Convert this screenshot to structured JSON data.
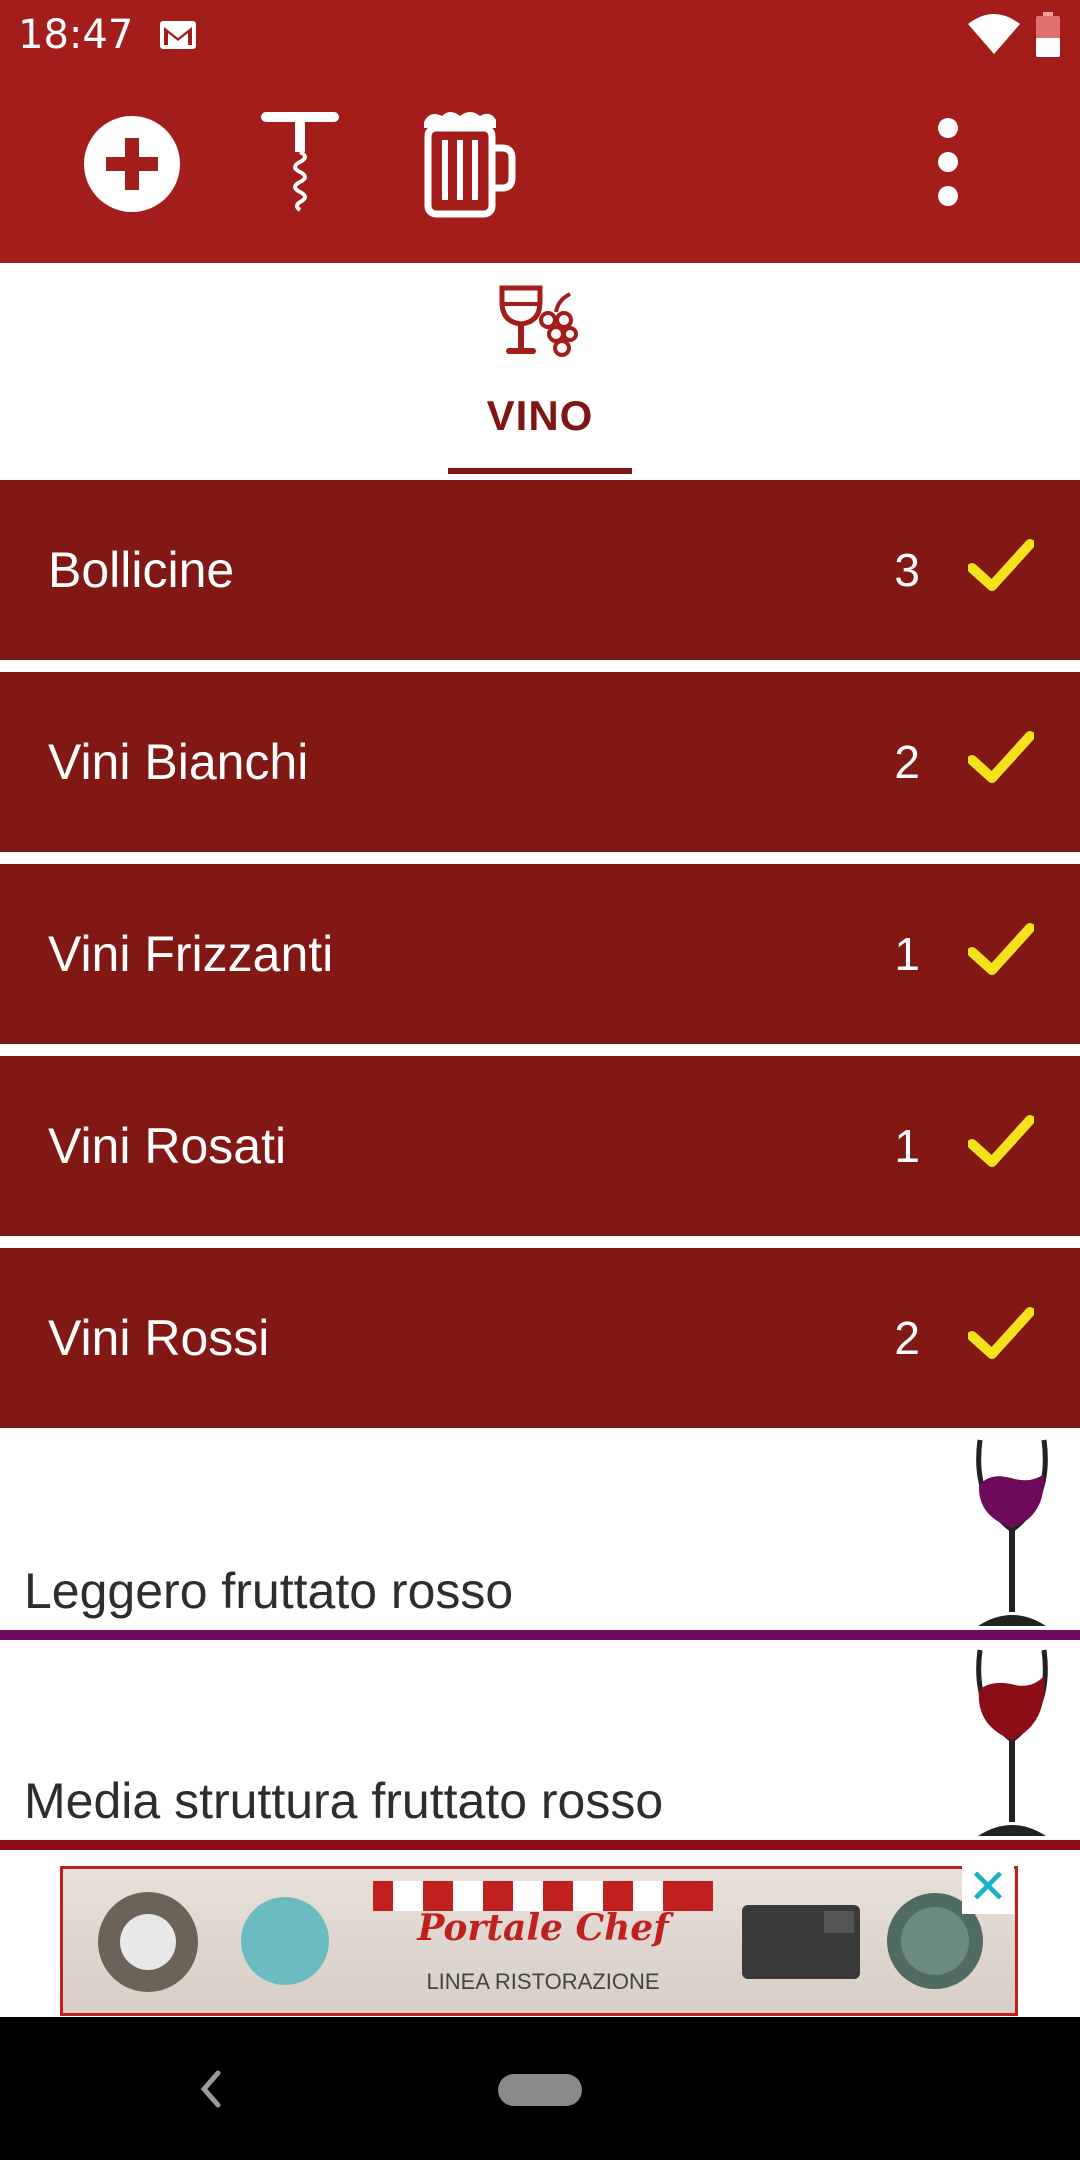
{
  "status_bar": {
    "time": "18:47"
  },
  "toolbar": {
    "actions": [
      "plus-circle-icon",
      "corkscrew-icon",
      "beer-mug-icon",
      "more-vert-icon"
    ]
  },
  "tab": {
    "label": "VINO",
    "icon": "wine-grapes-icon"
  },
  "categories": [
    {
      "label": "Bollicine",
      "count": "3"
    },
    {
      "label": "Vini Bianchi",
      "count": "2"
    },
    {
      "label": "Vini Frizzanti",
      "count": "1"
    },
    {
      "label": "Vini Rosati",
      "count": "1"
    },
    {
      "label": "Vini Rossi",
      "count": "2"
    }
  ],
  "wine_styles": [
    {
      "label": "Leggero fruttato rosso",
      "color": "#6d0a5a"
    },
    {
      "label": "Media struttura fruttato rosso",
      "color": "#8b0d16"
    }
  ],
  "ad": {
    "brand": "Portale Chef",
    "subtitle": "LINEA RISTORAZIONE"
  },
  "colors": {
    "primary": "#a31d1a",
    "row": "#821813",
    "check": "#f2e21b"
  }
}
